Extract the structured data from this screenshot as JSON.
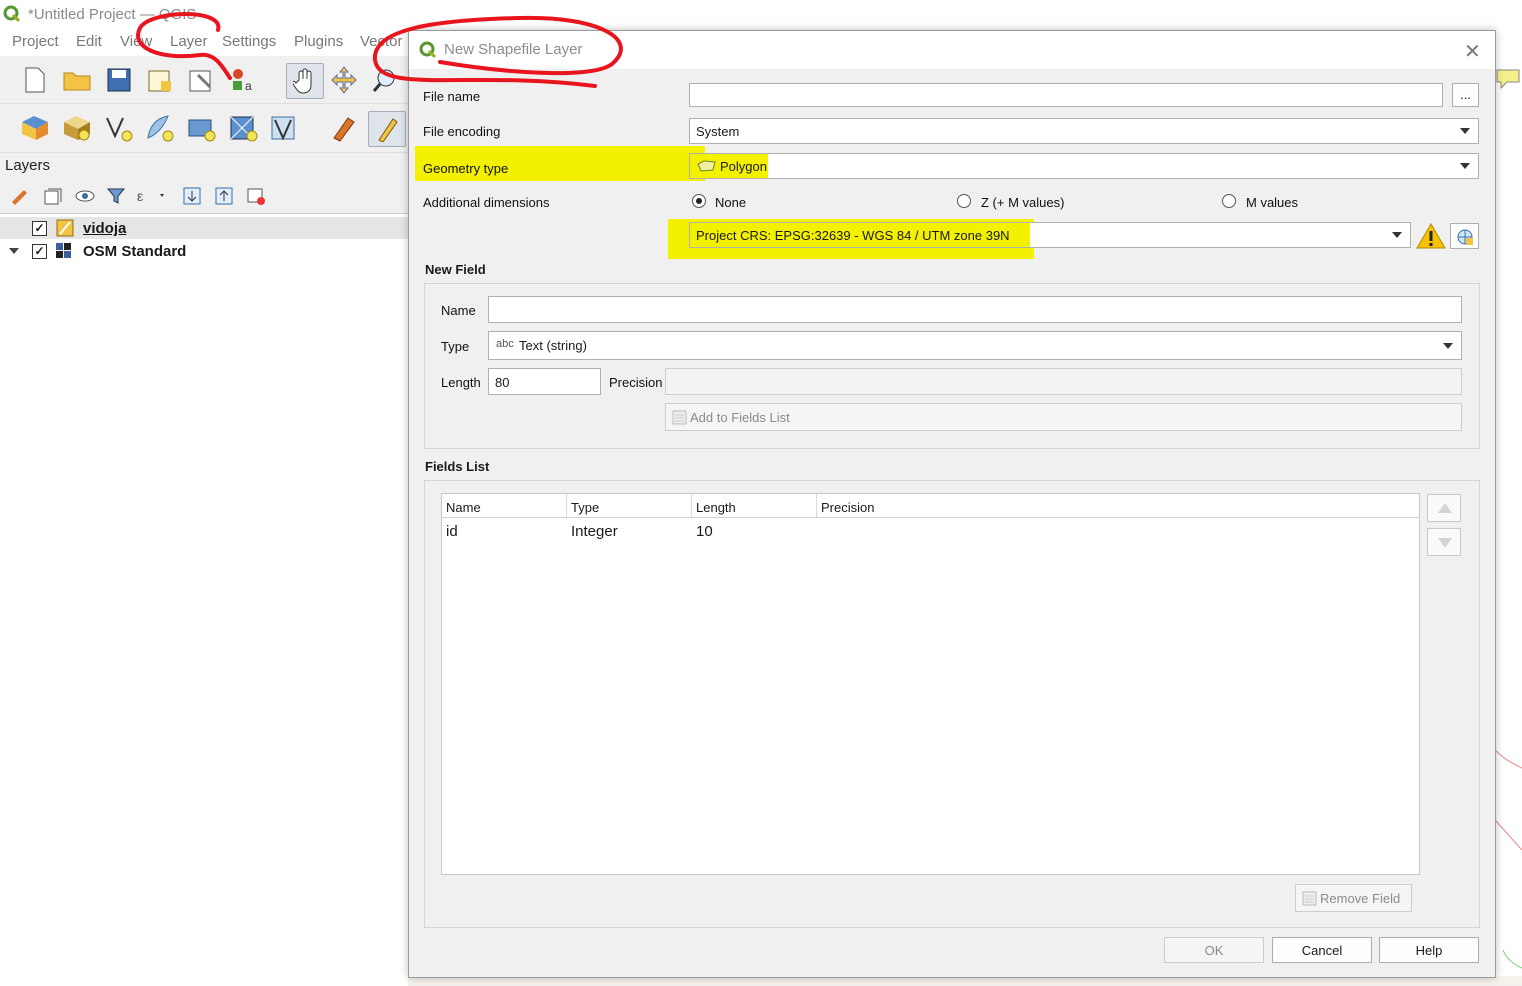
{
  "window": {
    "title": "*Untitled Project — QGIS",
    "menu": [
      "Project",
      "Edit",
      "View",
      "Layer",
      "Settings",
      "Plugins",
      "Vector"
    ]
  },
  "layers_panel": {
    "title": "Layers",
    "layers": [
      {
        "name": "vidoja",
        "checked": true,
        "icon": "polygon-layer-icon"
      },
      {
        "name": "OSM Standard",
        "checked": true,
        "icon": "xyz-tile-layer-icon"
      }
    ]
  },
  "dialog": {
    "title": "New Shapefile Layer",
    "file_name_label": "File name",
    "file_name_value": "",
    "browse_label": "...",
    "file_encoding_label": "File encoding",
    "file_encoding_value": "System",
    "geometry_type_label": "Geometry type",
    "geometry_type_value": "Polygon",
    "additional_dimensions_label": "Additional dimensions",
    "dimension_options": [
      "None",
      "Z (+ M values)",
      "M values"
    ],
    "dimension_selected": "None",
    "crs_value": "Project CRS: EPSG:32639 - WGS 84 / UTM zone 39N",
    "new_field": {
      "title": "New Field",
      "name_label": "Name",
      "name_value": "",
      "type_label": "Type",
      "type_prefix": "abc",
      "type_value": "Text (string)",
      "length_label": "Length",
      "length_value": "80",
      "precision_label": "Precision",
      "precision_value": "",
      "add_button": "Add to Fields List"
    },
    "fields_list": {
      "title": "Fields List",
      "columns": [
        "Name",
        "Type",
        "Length",
        "Precision"
      ],
      "rows": [
        [
          "id",
          "Integer",
          "10",
          ""
        ]
      ],
      "remove_button": "Remove Field"
    },
    "buttons": {
      "ok": "OK",
      "cancel": "Cancel",
      "help": "Help"
    },
    "highlight_color": "#f3f100",
    "annotation_color": "#e8141e"
  }
}
